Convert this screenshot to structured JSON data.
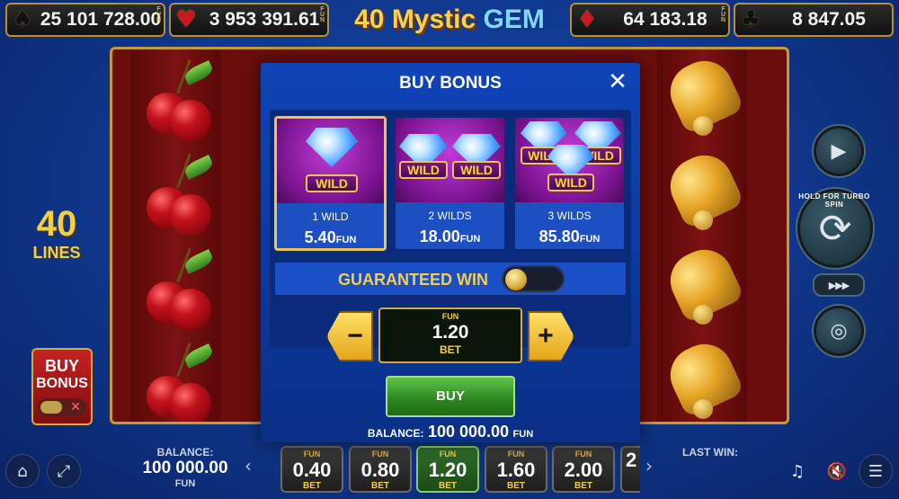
{
  "jackpots": [
    {
      "suit": "♠",
      "suit_name": "spade",
      "amount": "25 101 728.00"
    },
    {
      "suit": "♥",
      "suit_name": "heart",
      "amount": "3 953 391.61"
    },
    {
      "suit": "♦",
      "suit_name": "diamond",
      "amount": "64 183.18"
    },
    {
      "suit": "♣",
      "suit_name": "club",
      "amount": "8 847.05"
    }
  ],
  "jackpot_currency": "FUN",
  "logo": {
    "part1": "40 Mystic ",
    "part2": "GEM"
  },
  "lines": {
    "count": "40",
    "label": "LINES"
  },
  "side_buy": {
    "line1": "BUY",
    "line2": "BONUS",
    "x": "✕"
  },
  "turbo_hint": "HOLD FOR TURBO SPIN",
  "controls": {
    "autoplay_icon": "▶",
    "spin_icon": "⟳",
    "fast_forward_icon": "▶▶▶",
    "coins_icon": "◎"
  },
  "bottom": {
    "home_icon": "⌂",
    "fullscreen_icon": "⤢",
    "balance_label": "BALANCE:",
    "balance_value": "100 000.00",
    "balance_currency": "FUN",
    "prev_icon": "‹",
    "next_icon": "›",
    "bets": [
      {
        "fun": "FUN",
        "value": "0.40",
        "label": "BET",
        "active": false
      },
      {
        "fun": "FUN",
        "value": "0.80",
        "label": "BET",
        "active": false
      },
      {
        "fun": "FUN",
        "value": "1.20",
        "label": "BET",
        "active": true
      },
      {
        "fun": "FUN",
        "value": "1.60",
        "label": "BET",
        "active": false
      },
      {
        "fun": "FUN",
        "value": "2.00",
        "label": "BET",
        "active": false
      },
      {
        "fun": "",
        "value": "2",
        "label": "",
        "active": false
      }
    ],
    "last_win_label": "LAST WIN:",
    "music_off_icon": "♫",
    "sound_off_icon": "🔇",
    "menu_icon": "☰"
  },
  "modal": {
    "title": "BUY BONUS",
    "close_icon": "✕",
    "options": [
      {
        "label": "1 WILD",
        "price": "5.40",
        "currency": "FUN",
        "wilds": 1,
        "selected": true
      },
      {
        "label": "2 WILDS",
        "price": "18.00",
        "currency": "FUN",
        "wilds": 2,
        "selected": false
      },
      {
        "label": "3 WILDS",
        "price": "85.80",
        "currency": "FUN",
        "wilds": 3,
        "selected": false
      }
    ],
    "wild_text": "WILD",
    "guaranteed_win": {
      "label": "GUARANTEED WIN",
      "enabled": false
    },
    "stepper": {
      "minus": "−",
      "plus": "+",
      "currency": "FUN",
      "value": "1.20",
      "label": "BET"
    },
    "buy_label": "BUY",
    "balance": {
      "label": "BALANCE:",
      "value": "100 000.00",
      "currency": "FUN"
    }
  },
  "colors": {
    "accent_gold": "#f2cf45",
    "modal_blue": "#0f44b8",
    "buy_green": "#2e8a22",
    "selected_border": "#f2c449"
  }
}
